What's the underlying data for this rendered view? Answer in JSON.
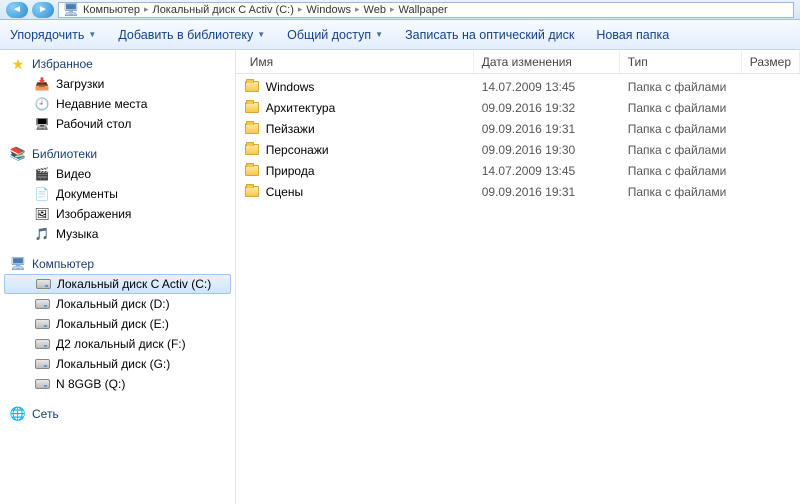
{
  "breadcrumb": {
    "items": [
      "Компьютер",
      "Локальный диск C Activ (C:)",
      "Windows",
      "Web",
      "Wallpaper"
    ]
  },
  "toolbar": {
    "organize": "Упорядочить",
    "add_library": "Добавить в библиотеку",
    "share": "Общий доступ",
    "burn": "Записать на оптический диск",
    "new_folder": "Новая папка"
  },
  "sidebar": {
    "favorites": {
      "label": "Избранное",
      "items": [
        {
          "label": "Загрузки"
        },
        {
          "label": "Недавние места"
        },
        {
          "label": "Рабочий стол"
        }
      ]
    },
    "libraries": {
      "label": "Библиотеки",
      "items": [
        {
          "label": "Видео"
        },
        {
          "label": "Документы"
        },
        {
          "label": "Изображения"
        },
        {
          "label": "Музыка"
        }
      ]
    },
    "computer": {
      "label": "Компьютер",
      "items": [
        {
          "label": "Локальный диск C Activ (C:)",
          "selected": true
        },
        {
          "label": "Локальный диск (D:)"
        },
        {
          "label": "Локальный диск (E:)"
        },
        {
          "label": "Д2 локальный диск (F:)"
        },
        {
          "label": "Локальный диск (G:)"
        },
        {
          "label": "N 8GGB (Q:)"
        }
      ]
    },
    "network": {
      "label": "Сеть"
    }
  },
  "columns": {
    "name": "Имя",
    "date": "Дата изменения",
    "type": "Тип",
    "size": "Размер"
  },
  "files": [
    {
      "name": "Windows",
      "date": "14.07.2009 13:45",
      "type": "Папка с файлами"
    },
    {
      "name": "Архитектура",
      "date": "09.09.2016 19:32",
      "type": "Папка с файлами"
    },
    {
      "name": "Пейзажи",
      "date": "09.09.2016 19:31",
      "type": "Папка с файлами"
    },
    {
      "name": "Персонажи",
      "date": "09.09.2016 19:30",
      "type": "Папка с файлами"
    },
    {
      "name": "Природа",
      "date": "14.07.2009 13:45",
      "type": "Папка с файлами"
    },
    {
      "name": "Сцены",
      "date": "09.09.2016 19:31",
      "type": "Папка с файлами"
    }
  ]
}
